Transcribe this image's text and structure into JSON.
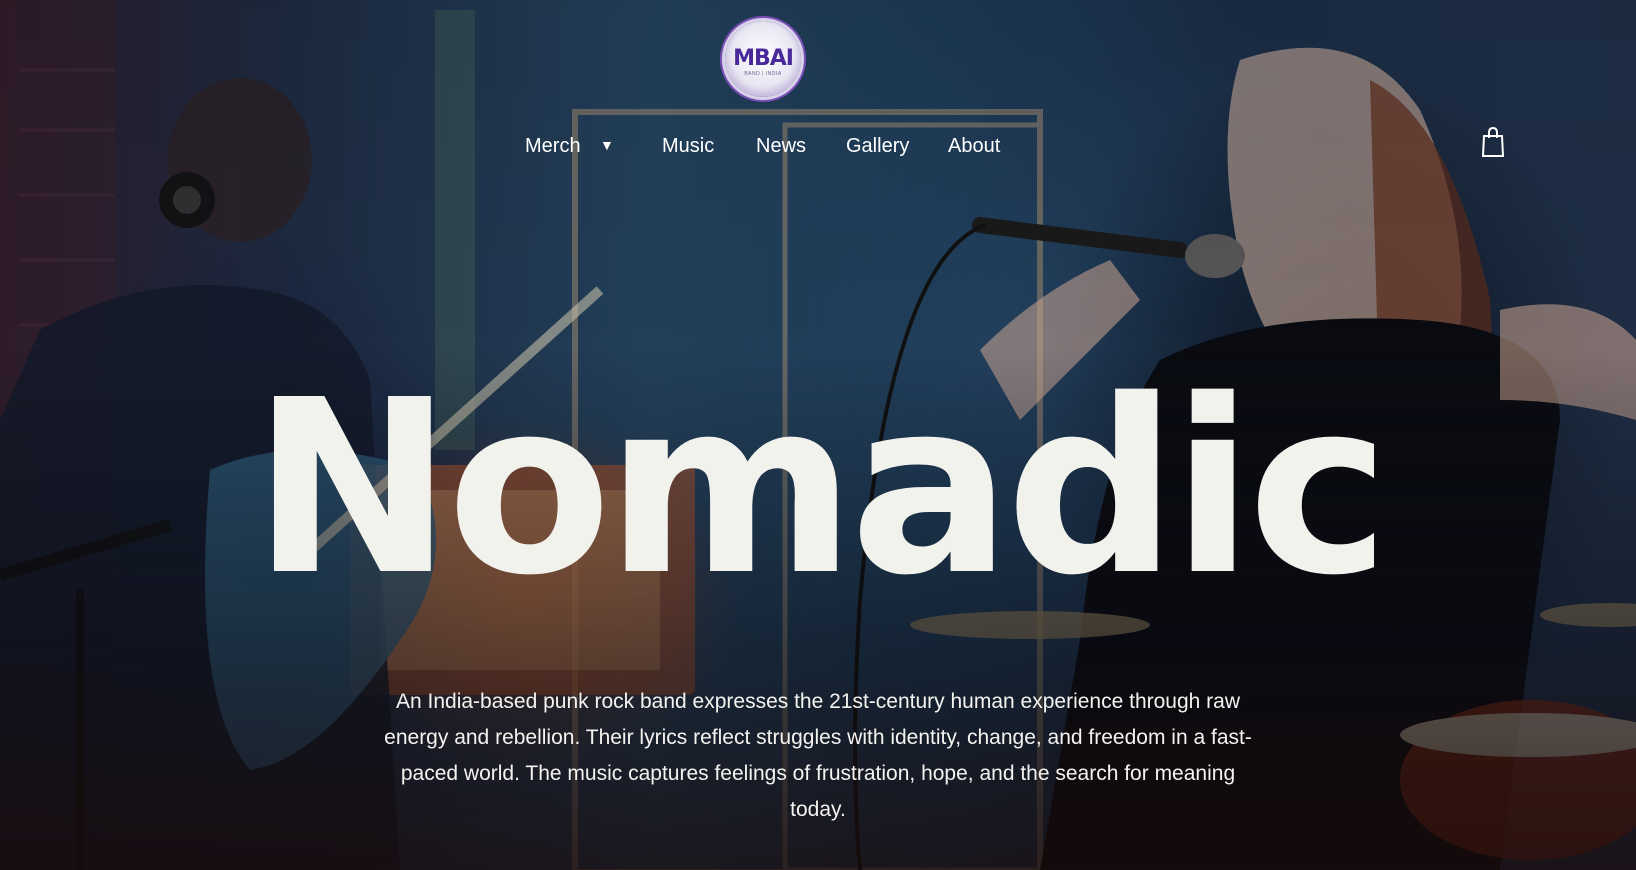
{
  "brand": {
    "logo_text": "MBAI",
    "logo_subtext": "BAND | INDIA"
  },
  "nav": {
    "items": [
      {
        "label": "Merch",
        "has_dropdown": true
      },
      {
        "label": "Music"
      },
      {
        "label": "News"
      },
      {
        "label": "Gallery"
      },
      {
        "label": "About"
      }
    ],
    "dropdown_caret": "▼",
    "cart_icon": "shopping-bag-icon"
  },
  "hero": {
    "title": "Nomadic",
    "description": "An India-based punk rock band expresses the 21st-century human experience through raw energy and rebellion. Their lyrics reflect struggles with identity, change, and freedom in a fast-paced world. The music captures feelings of frustration, hope, and the search for meaning today.",
    "background": "band-performance-photo"
  },
  "colors": {
    "title": "#f2f2ed",
    "nav_text": "#ffffff",
    "logo_accent": "#4a2a9a"
  }
}
